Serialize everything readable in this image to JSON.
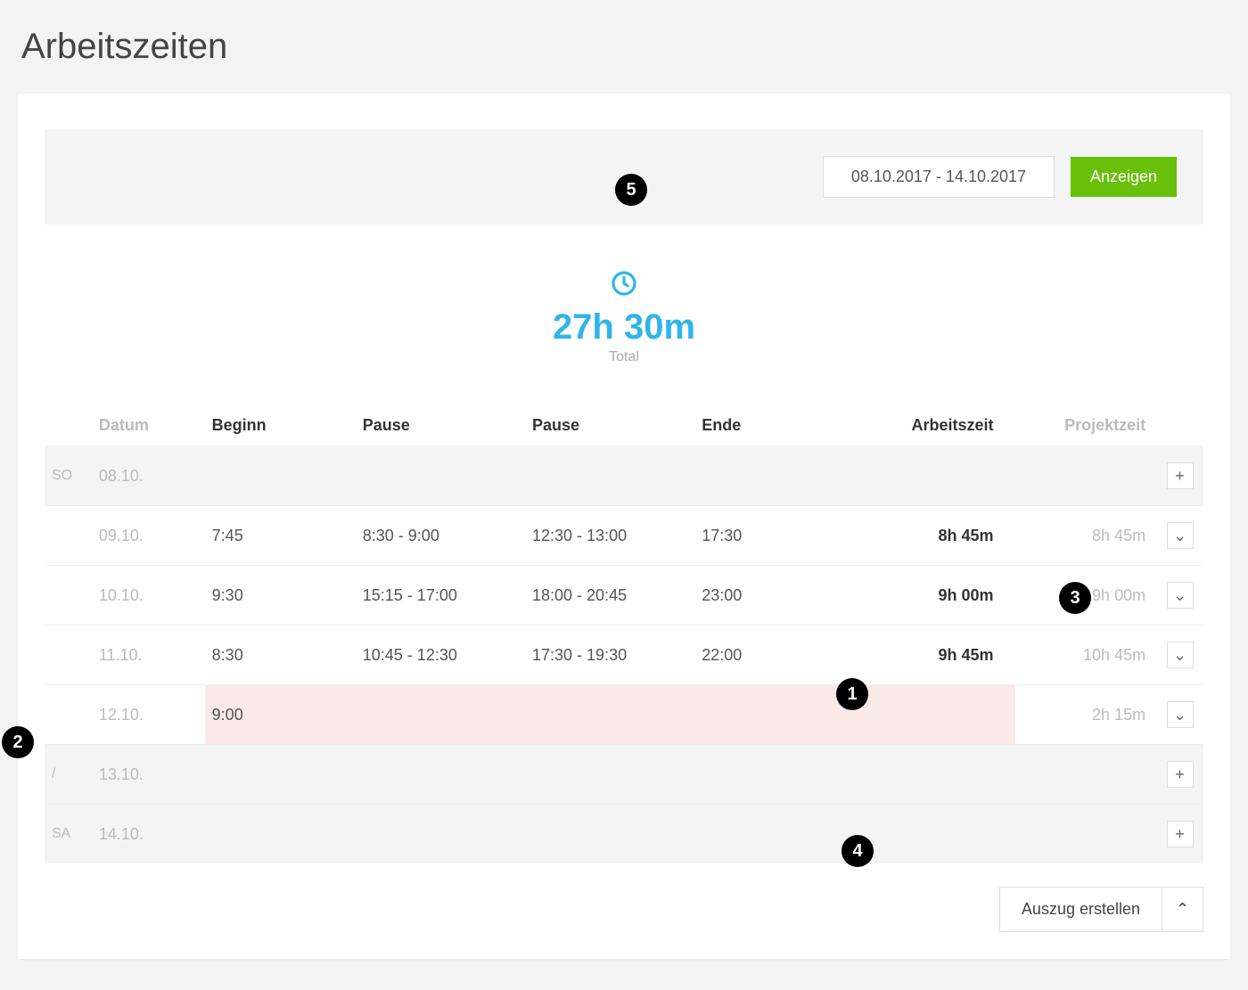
{
  "page": {
    "title": "Arbeitszeiten"
  },
  "filter": {
    "date_range": "08.10.2017 - 14.10.2017",
    "show_label": "Anzeigen"
  },
  "summary": {
    "total_value": "27h 30m",
    "total_label": "Total"
  },
  "columns": {
    "date": "Datum",
    "begin": "Beginn",
    "pause1": "Pause",
    "pause2": "Pause",
    "end": "Ende",
    "work": "Arbeitszeit",
    "project": "Projektzeit"
  },
  "rows": [
    {
      "day": "SO",
      "date": "08.10.",
      "begin": "",
      "pause1": "",
      "pause2": "",
      "end": "",
      "work": "",
      "project": "",
      "action": "plus",
      "shaded": true
    },
    {
      "day": "",
      "date": "09.10.",
      "begin": "7:45",
      "pause1": "8:30 - 9:00",
      "pause2": "12:30 - 13:00",
      "end": "17:30",
      "work": "8h 45m",
      "project": "8h 45m",
      "action": "chevron"
    },
    {
      "day": "",
      "date": "10.10.",
      "begin": "9:30",
      "pause1": "15:15 - 17:00",
      "pause2": "18:00 - 20:45",
      "end": "23:00",
      "work": "9h 00m",
      "project": "9h 00m",
      "action": "chevron"
    },
    {
      "day": "",
      "date": "11.10.",
      "begin": "8:30",
      "pause1": "10:45 - 12:30",
      "pause2": "17:30 - 19:30",
      "end": "22:00",
      "work": "9h 45m",
      "project": "10h 45m",
      "action": "chevron"
    },
    {
      "day": "",
      "date": "12.10.",
      "begin": "9:00",
      "pause1": "",
      "pause2": "",
      "end": "",
      "work": "",
      "project": "2h 15m",
      "action": "chevron",
      "highlight": true
    },
    {
      "day": "/",
      "date": "13.10.",
      "begin": "",
      "pause1": "",
      "pause2": "",
      "end": "",
      "work": "",
      "project": "",
      "action": "plus",
      "shaded": true
    },
    {
      "day": "SA",
      "date": "14.10.",
      "begin": "",
      "pause1": "",
      "pause2": "",
      "end": "",
      "work": "",
      "project": "",
      "action": "plus",
      "shaded": true
    }
  ],
  "export": {
    "label": "Auszug erstellen"
  },
  "callouts": {
    "c1": "1",
    "c2": "2",
    "c3": "3",
    "c4": "4",
    "c5": "5"
  }
}
